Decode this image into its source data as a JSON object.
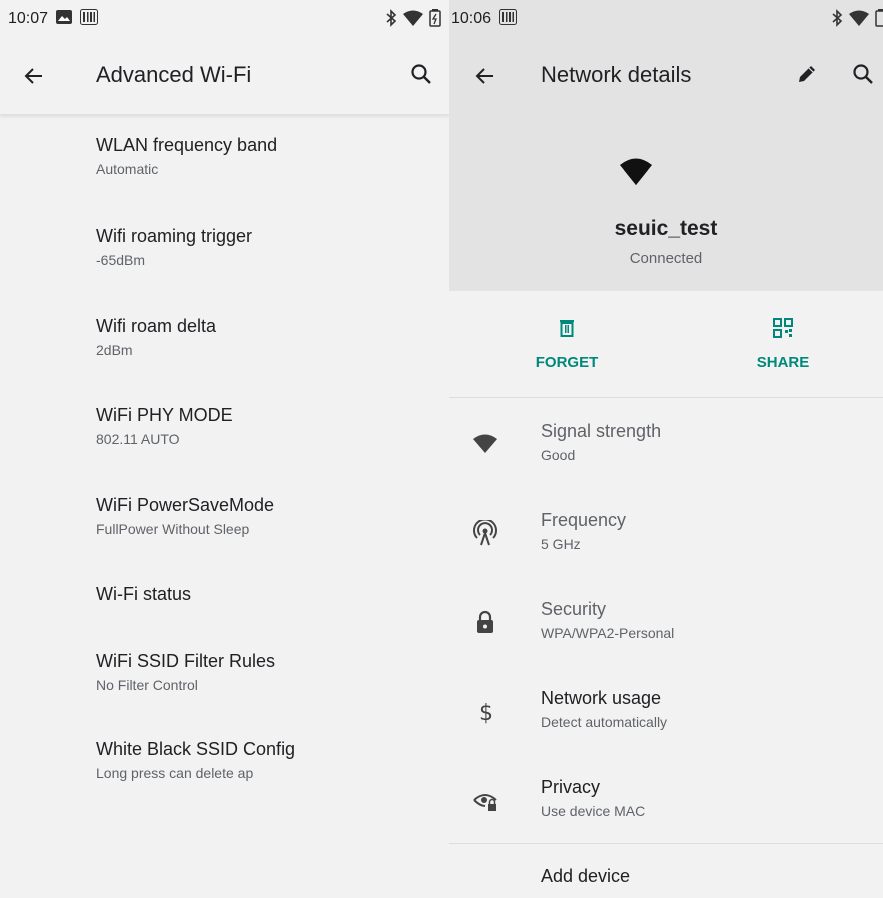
{
  "left": {
    "status": {
      "time": "10:07"
    },
    "title": "Advanced Wi-Fi",
    "items": [
      {
        "title": "WLAN frequency band",
        "summary": "Automatic"
      },
      {
        "title": "Wifi roaming trigger",
        "summary": "-65dBm"
      },
      {
        "title": "Wifi roam delta",
        "summary": "2dBm"
      },
      {
        "title": "WiFi PHY MODE",
        "summary": "802.11 AUTO"
      },
      {
        "title": "WiFi PowerSaveMode",
        "summary": "FullPower Without Sleep"
      },
      {
        "title": "Wi-Fi status",
        "summary": ""
      },
      {
        "title": "WiFi SSID Filter Rules",
        "summary": "No Filter Control"
      },
      {
        "title": "White Black SSID Config",
        "summary": "Long press can delete ap"
      }
    ]
  },
  "right": {
    "status": {
      "time": "10:06"
    },
    "title": "Network details",
    "network": {
      "name": "seuic_test",
      "status": "Connected"
    },
    "actions": {
      "forget": "FORGET",
      "share": "SHARE"
    },
    "details": [
      {
        "icon": "wifi-signal-icon",
        "title": "Signal strength",
        "summary": "Good"
      },
      {
        "icon": "antenna-icon",
        "title": "Frequency",
        "summary": "5 GHz"
      },
      {
        "icon": "lock-icon",
        "title": "Security",
        "summary": "WPA/WPA2-Personal"
      },
      {
        "icon": "dollar-icon",
        "title": "Network usage",
        "summary": "Detect automatically"
      },
      {
        "icon": "privacy-eye-icon",
        "title": "Privacy",
        "summary": "Use device MAC"
      },
      {
        "icon": "",
        "title": "Add device",
        "summary": ""
      }
    ]
  },
  "colors": {
    "accent": "#00897b",
    "header_bg": "#e3e3e3",
    "page_bg": "#f2f2f2"
  }
}
